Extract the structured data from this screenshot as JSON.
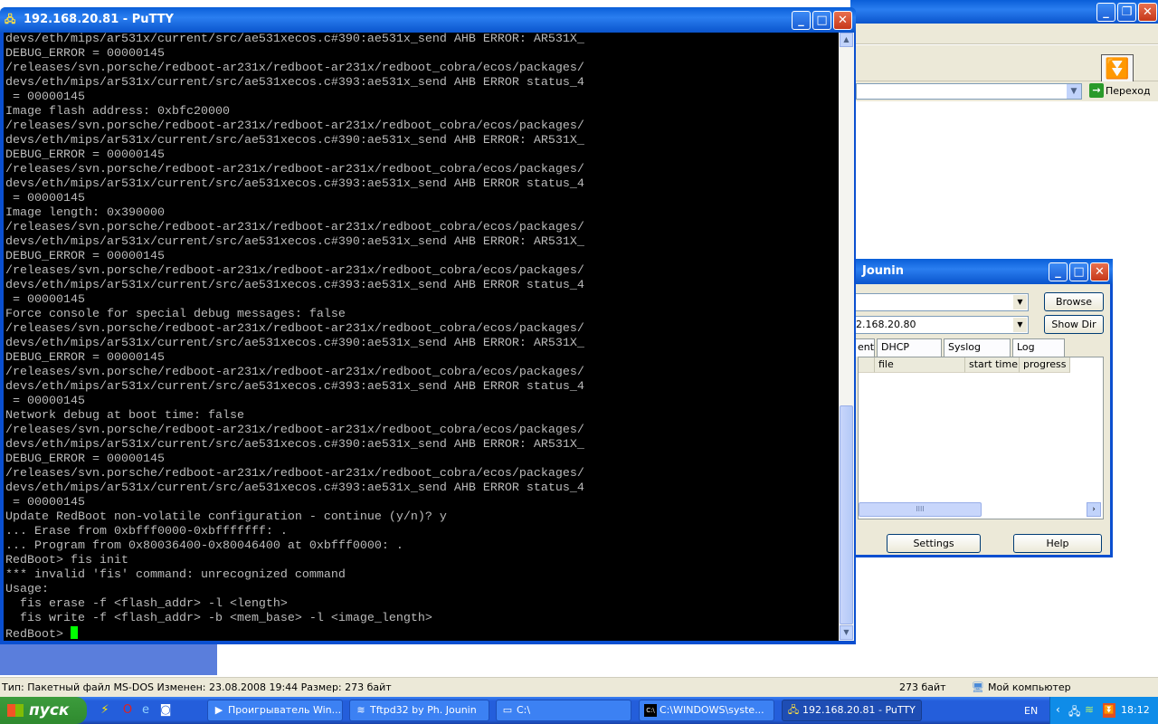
{
  "putty": {
    "title": "192.168.20.81 - PuTTY",
    "terminal_lines": [
      "devs/eth/mips/ar531x/current/src/ae531xecos.c#390:ae531x_send AHB ERROR: AR531X_",
      "DEBUG_ERROR = 00000145",
      "/releases/svn.porsche/redboot-ar231x/redboot-ar231x/redboot_cobra/ecos/packages/",
      "devs/eth/mips/ar531x/current/src/ae531xecos.c#393:ae531x_send AHB ERROR status_4",
      " = 00000145",
      "Image flash address: 0xbfc20000",
      "/releases/svn.porsche/redboot-ar231x/redboot-ar231x/redboot_cobra/ecos/packages/",
      "devs/eth/mips/ar531x/current/src/ae531xecos.c#390:ae531x_send AHB ERROR: AR531X_",
      "DEBUG_ERROR = 00000145",
      "/releases/svn.porsche/redboot-ar231x/redboot-ar231x/redboot_cobra/ecos/packages/",
      "devs/eth/mips/ar531x/current/src/ae531xecos.c#393:ae531x_send AHB ERROR status_4",
      " = 00000145",
      "Image length: 0x390000",
      "/releases/svn.porsche/redboot-ar231x/redboot-ar231x/redboot_cobra/ecos/packages/",
      "devs/eth/mips/ar531x/current/src/ae531xecos.c#390:ae531x_send AHB ERROR: AR531X_",
      "DEBUG_ERROR = 00000145",
      "/releases/svn.porsche/redboot-ar231x/redboot-ar231x/redboot_cobra/ecos/packages/",
      "devs/eth/mips/ar531x/current/src/ae531xecos.c#393:ae531x_send AHB ERROR status_4",
      " = 00000145",
      "Force console for special debug messages: false",
      "/releases/svn.porsche/redboot-ar231x/redboot-ar231x/redboot_cobra/ecos/packages/",
      "devs/eth/mips/ar531x/current/src/ae531xecos.c#390:ae531x_send AHB ERROR: AR531X_",
      "DEBUG_ERROR = 00000145",
      "/releases/svn.porsche/redboot-ar231x/redboot-ar231x/redboot_cobra/ecos/packages/",
      "devs/eth/mips/ar531x/current/src/ae531xecos.c#393:ae531x_send AHB ERROR status_4",
      " = 00000145",
      "Network debug at boot time: false",
      "/releases/svn.porsche/redboot-ar231x/redboot-ar231x/redboot_cobra/ecos/packages/",
      "devs/eth/mips/ar531x/current/src/ae531xecos.c#390:ae531x_send AHB ERROR: AR531X_",
      "DEBUG_ERROR = 00000145",
      "/releases/svn.porsche/redboot-ar231x/redboot-ar231x/redboot_cobra/ecos/packages/",
      "devs/eth/mips/ar531x/current/src/ae531xecos.c#393:ae531x_send AHB ERROR status_4",
      " = 00000145",
      "Update RedBoot non-volatile configuration - continue (y/n)? y",
      "... Erase from 0xbfff0000-0xbfffffff: .",
      "... Program from 0x80036400-0x80046400 at 0xbfff0000: .",
      "RedBoot> fis init",
      "*** invalid 'fis' command: unrecognized command",
      "Usage:",
      "  fis erase -f <flash_addr> -l <length>",
      "  fis write -f <flash_addr> -b <mem_base> -l <image_length>"
    ],
    "prompt": "RedBoot> "
  },
  "explorer": {
    "go_label": "Переход"
  },
  "tftpd": {
    "title": "Jounin",
    "dir_value": "",
    "server_interface": "2.168.20.80",
    "browse_label": "Browse",
    "showdir_label": "Show Dir",
    "tabs": [
      "ent",
      "DHCP server",
      "Syslog server",
      "Log viewer"
    ],
    "columns": [
      "file",
      "start time",
      "progress"
    ],
    "settings_label": "Settings",
    "help_label": "Help"
  },
  "statusbar": {
    "info": "Тип: Пакетный файл MS-DOS Изменен: 23.08.2008 19:44 Размер: 273 байт",
    "size": "273 байт",
    "location": "Мой компьютер"
  },
  "taskbar": {
    "start_label": "пуск",
    "items": [
      "Проигрыватель Win...",
      "Tftpd32 by Ph. Jounin",
      "C:\\",
      "C:\\WINDOWS\\syste...",
      "192.168.20.81 - PuTTY"
    ],
    "lang": "EN",
    "clock": "18:12"
  }
}
